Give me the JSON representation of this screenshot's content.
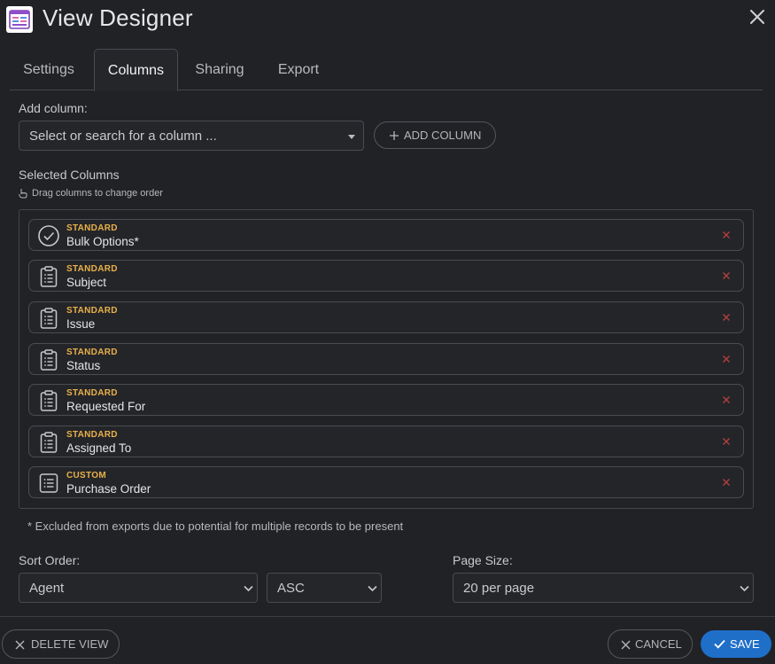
{
  "window": {
    "title": "View Designer",
    "app_icon": "view-designer-icon",
    "close_icon": "close-icon"
  },
  "tabs": [
    {
      "label": "Settings",
      "active": false
    },
    {
      "label": "Columns",
      "active": true
    },
    {
      "label": "Sharing",
      "active": false
    },
    {
      "label": "Export",
      "active": false
    }
  ],
  "add_column": {
    "label": "Add column:",
    "placeholder": "Select or search for a column ...",
    "button_label": "ADD COLUMN",
    "button_icon": "plus-icon"
  },
  "selected_columns": {
    "heading": "Selected Columns",
    "drag_hint": "Drag columns to change order",
    "drag_hint_icon": "hand-pointer-icon",
    "items": [
      {
        "type": "STANDARD",
        "name": "Bulk Options*",
        "icon": "check-circle-icon"
      },
      {
        "type": "STANDARD",
        "name": "Subject",
        "icon": "clipboard-list-icon"
      },
      {
        "type": "STANDARD",
        "name": "Issue",
        "icon": "clipboard-list-icon"
      },
      {
        "type": "STANDARD",
        "name": "Status",
        "icon": "clipboard-list-icon"
      },
      {
        "type": "STANDARD",
        "name": "Requested For",
        "icon": "clipboard-list-icon"
      },
      {
        "type": "STANDARD",
        "name": "Assigned To",
        "icon": "clipboard-list-icon"
      },
      {
        "type": "CUSTOM",
        "name": "Purchase Order",
        "icon": "list-box-icon"
      }
    ]
  },
  "footnote": "* Excluded from exports due to potential for multiple records to be present",
  "sort": {
    "label": "Sort Order:",
    "field_value": "Agent",
    "direction_value": "ASC"
  },
  "page_size": {
    "label": "Page Size:",
    "value": "20 per page"
  },
  "footer": {
    "delete_label": "DELETE VIEW",
    "cancel_label": "CANCEL",
    "save_label": "SAVE"
  },
  "colors": {
    "background": "#212226",
    "accent": "#1f6fc9",
    "type_label": "#e8b04a",
    "remove_icon": "#b5403e"
  }
}
